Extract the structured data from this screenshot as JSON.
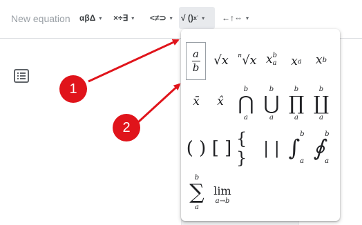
{
  "toolbar": {
    "new_equation": "New equation",
    "greek": "αβΔ",
    "operators": "×÷∃",
    "relations": "<≠⊃",
    "math_ops": "√ ()",
    "arrows": "←↑⇔",
    "caret": "▾"
  },
  "symbols": {
    "fraction_num": "a",
    "fraction_den": "b",
    "sqrt": "√x",
    "nthroot_index": "n",
    "nthroot": "√x",
    "supsub_base": "x",
    "supsub_sup": "b",
    "supsub_sub": "a",
    "sub_base": "x",
    "sub": "a",
    "sup_base": "x",
    "sup": "b",
    "bar": "x̄",
    "hat": "x̂",
    "cap": "⋂",
    "cup": "⋃",
    "prod": "∏",
    "coprod": "∐",
    "limit_upper": "b",
    "limit_lower": "a",
    "paren": "( )",
    "bracket": "[ ]",
    "brace": "{ }",
    "abs": "| |",
    "integral": "∫",
    "contour": "∮",
    "sum": "∑",
    "lim": "lim",
    "lim_sub": "a→b"
  },
  "callouts": {
    "one": "1",
    "two": "2"
  },
  "colors": {
    "callout": "#e0141b",
    "accent_toolbar_active": "#e8eaed"
  }
}
